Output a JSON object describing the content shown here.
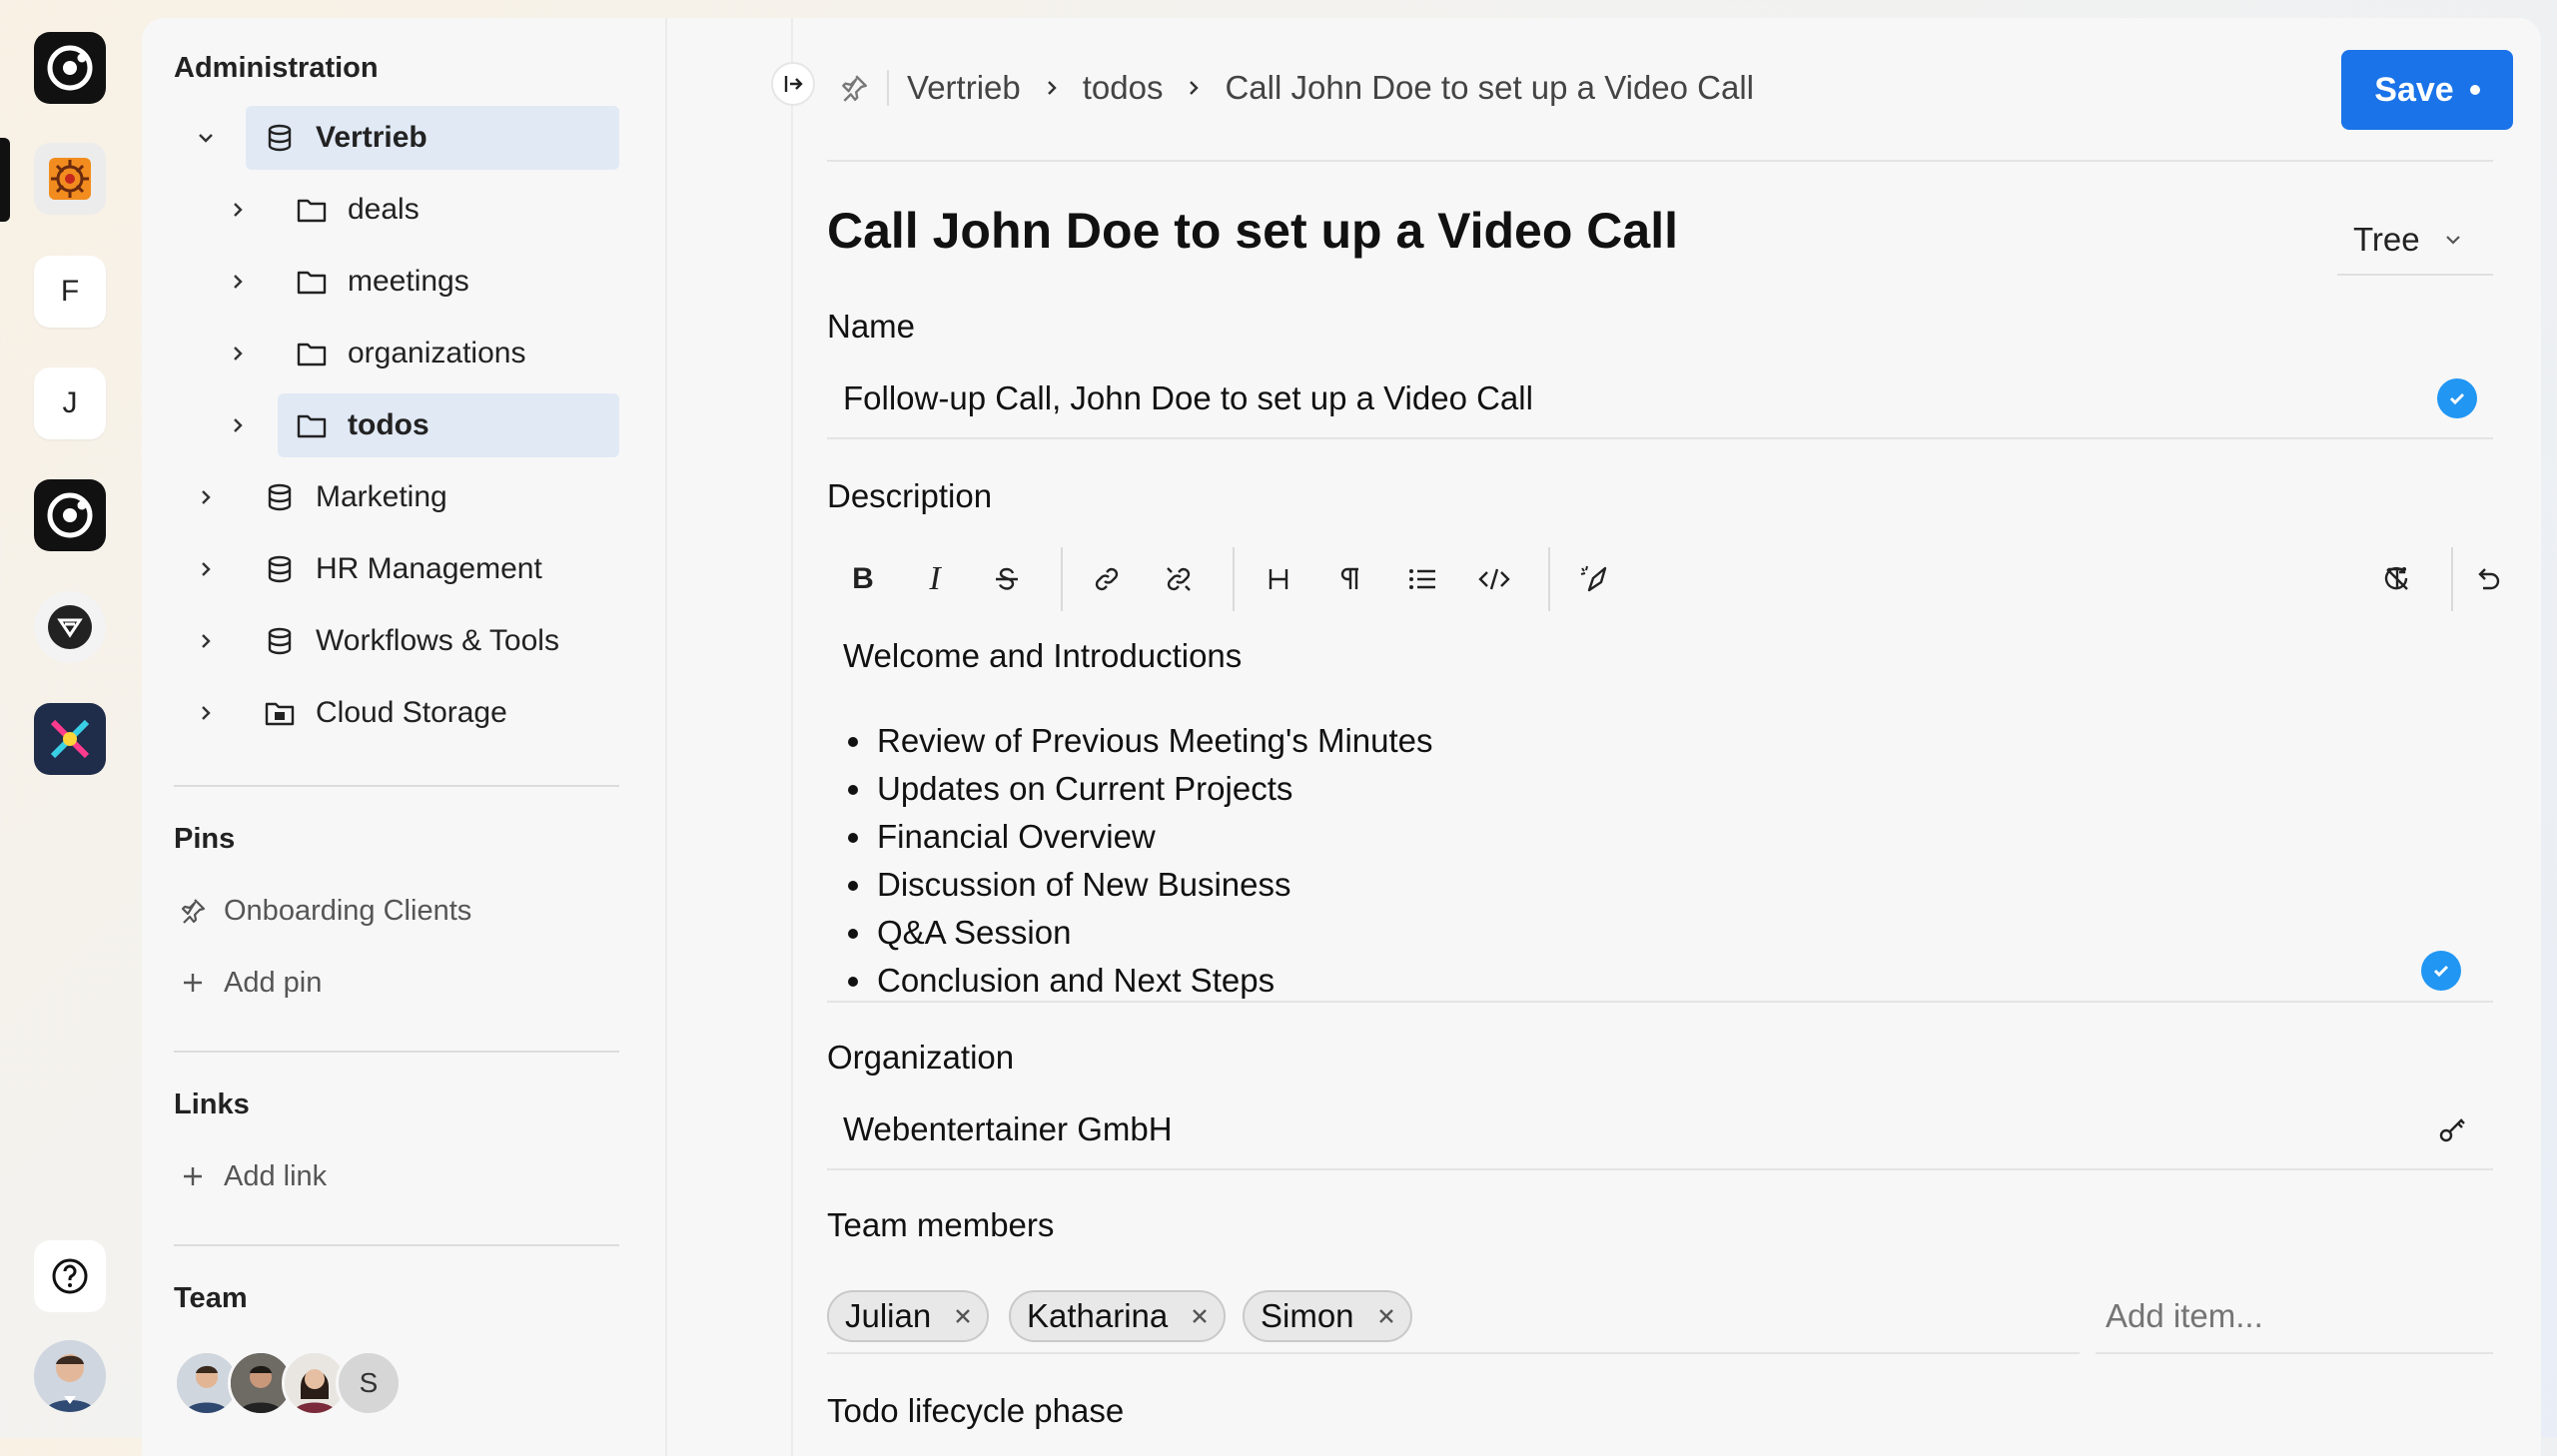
{
  "rail": {
    "letter_items": [
      "F",
      "J"
    ]
  },
  "sidebar": {
    "administration_title": "Administration",
    "tree": [
      {
        "label": "Vertrieb",
        "level": 0,
        "icon": "database-icon",
        "selected": true,
        "bold": true
      },
      {
        "label": "deals",
        "level": 1,
        "icon": "folder-icon",
        "selected": false,
        "bold": false
      },
      {
        "label": "meetings",
        "level": 1,
        "icon": "folder-icon",
        "selected": false,
        "bold": false
      },
      {
        "label": "organizations",
        "level": 1,
        "icon": "folder-icon",
        "selected": false,
        "bold": false
      },
      {
        "label": "todos",
        "level": 1,
        "icon": "folder-icon",
        "selected": true,
        "bold": true
      },
      {
        "label": "Marketing",
        "level": 0,
        "icon": "database-icon",
        "selected": false,
        "bold": false
      },
      {
        "label": "HR Management",
        "level": 0,
        "icon": "database-icon",
        "selected": false,
        "bold": false
      },
      {
        "label": "Workflows & Tools",
        "level": 0,
        "icon": "database-icon",
        "selected": false,
        "bold": false
      },
      {
        "label": "Cloud Storage",
        "level": 0,
        "icon": "cloud-storage-icon",
        "selected": false,
        "bold": false
      }
    ],
    "pins_title": "Pins",
    "pins": [
      {
        "label": "Onboarding Clients"
      }
    ],
    "add_pin_label": "Add pin",
    "links_title": "Links",
    "add_link_label": "Add link",
    "team_title": "Team",
    "team_avatars": [
      "person",
      "person",
      "person",
      "S"
    ]
  },
  "header": {
    "breadcrumb": [
      "Vertrieb",
      "todos",
      "Call John Doe to set up a Video Call"
    ],
    "save_label": "Save"
  },
  "page": {
    "title": "Call John Doe to set up a Video Call",
    "view_mode": "Tree"
  },
  "fields": {
    "name_label": "Name",
    "name_value": "Follow-up Call, John Doe to set up a Video Call",
    "description_label": "Description",
    "description_heading": "Welcome and Introductions",
    "description_items": [
      "Review of Previous Meeting's Minutes",
      "Updates on Current Projects",
      "Financial Overview",
      "Discussion of New Business",
      "Q&A Session",
      "Conclusion and Next Steps"
    ],
    "organization_label": "Organization",
    "organization_value": "Webentertainer GmbH",
    "team_members_label": "Team members",
    "team_members": [
      "Julian",
      "Katharina",
      "Simon"
    ],
    "add_item_placeholder": "Add item...",
    "lifecycle_label": "Todo lifecycle phase"
  },
  "toolbar_icons": [
    "bold-icon",
    "italic-icon",
    "strikethrough-icon",
    "link-icon",
    "unlink-icon",
    "heading-icon",
    "paragraph-icon",
    "bullet-list-icon",
    "code-icon",
    "magic-pen-icon",
    "clear-format-icon",
    "undo-icon",
    "redo-icon"
  ],
  "colors": {
    "accent": "#1a73e8",
    "check": "#2196f3",
    "selection": "#e1e9f5"
  }
}
